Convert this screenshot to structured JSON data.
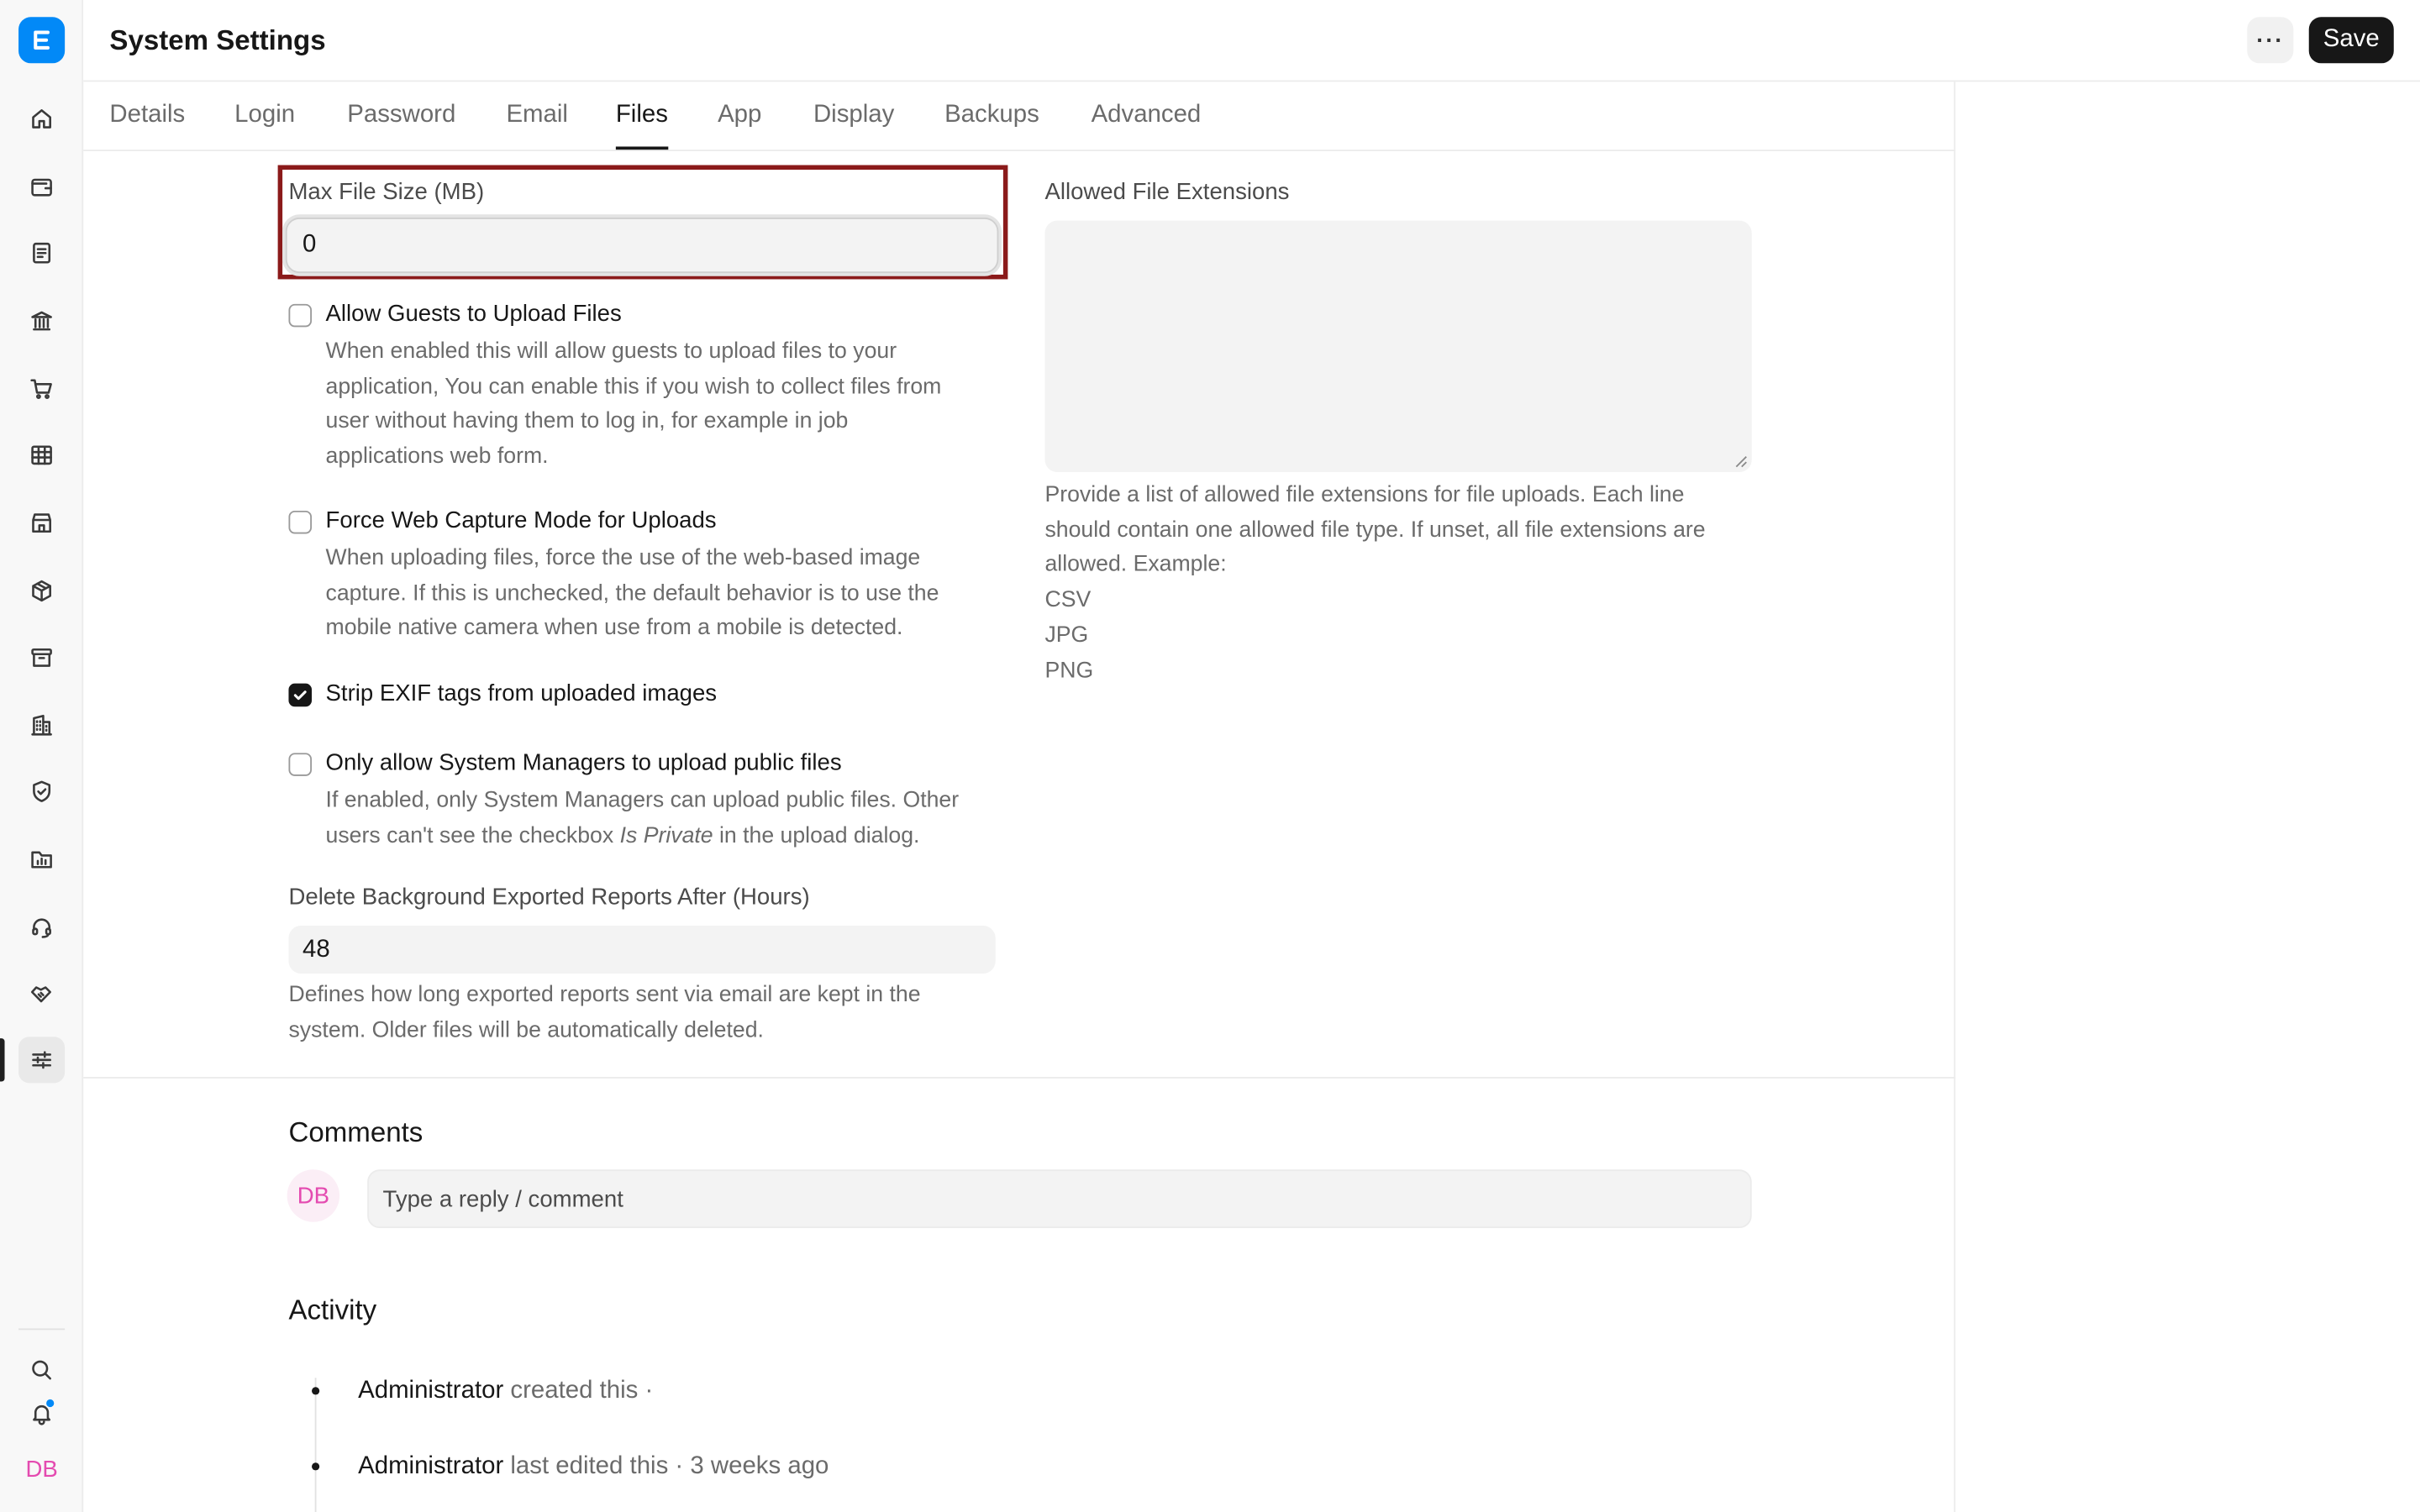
{
  "app": {
    "logo_letter": "E"
  },
  "header": {
    "title": "System Settings",
    "more_label": "···",
    "save_label": "Save"
  },
  "tabs": [
    {
      "label": "Details"
    },
    {
      "label": "Login"
    },
    {
      "label": "Password"
    },
    {
      "label": "Email"
    },
    {
      "label": "Files"
    },
    {
      "label": "App"
    },
    {
      "label": "Display"
    },
    {
      "label": "Backups"
    },
    {
      "label": "Advanced"
    }
  ],
  "active_tab": "Files",
  "form": {
    "max_file_size": {
      "label": "Max File Size (MB)",
      "value": "0"
    },
    "allowed_ext": {
      "label": "Allowed File Extensions",
      "value": "",
      "help": [
        "Provide a list of allowed file extensions for file uploads. Each line",
        "should contain one allowed file type. If unset, all file extensions are",
        "allowed. Example:",
        "CSV",
        "JPG",
        "PNG"
      ]
    },
    "allow_guests": {
      "label": "Allow Guests to Upload Files",
      "checked": false,
      "desc": [
        "When enabled this will allow guests to upload files to your",
        "application, You can enable this if you wish to collect files from",
        "user without having them to log in, for example in job",
        "applications web form."
      ]
    },
    "force_web_capture": {
      "label": "Force Web Capture Mode for Uploads",
      "checked": false,
      "desc": [
        "When uploading files, force the use of the web-based image",
        "capture. If this is unchecked, the default behavior is to use the",
        "mobile native camera when use from a mobile is detected."
      ]
    },
    "strip_exif": {
      "label": "Strip EXIF tags from uploaded images",
      "checked": true
    },
    "only_managers": {
      "label": "Only allow System Managers to upload public files",
      "checked": false,
      "desc_line1": "If enabled, only System Managers can upload public files. Other",
      "desc_line2_pre": "users can't see the checkbox ",
      "desc_line2_em": "Is Private",
      "desc_line2_post": " in the upload dialog."
    },
    "delete_reports": {
      "label": "Delete Background Exported Reports After (Hours)",
      "value": "48",
      "desc": [
        "Defines how long exported reports sent via email are kept in the",
        "system. Older files will be automatically deleted."
      ]
    }
  },
  "comments": {
    "title": "Comments",
    "avatar_initials": "DB",
    "placeholder": "Type a reply / comment"
  },
  "activity": {
    "title": "Activity",
    "items": [
      {
        "user": "Administrator",
        "text": " created this ·"
      },
      {
        "user": "Administrator",
        "text": " last edited this · 3 weeks ago"
      }
    ]
  },
  "sidebar": {
    "items": [
      {
        "icon": "home-icon"
      },
      {
        "icon": "wallet-icon"
      },
      {
        "icon": "document-icon"
      },
      {
        "icon": "bank-icon"
      },
      {
        "icon": "cart-icon"
      },
      {
        "icon": "table-icon"
      },
      {
        "icon": "store-icon"
      },
      {
        "icon": "package-icon"
      },
      {
        "icon": "archive-icon"
      },
      {
        "icon": "building-icon"
      },
      {
        "icon": "shield-icon"
      },
      {
        "icon": "folder-chart-icon"
      },
      {
        "icon": "headset-icon"
      },
      {
        "icon": "handshake-icon"
      },
      {
        "icon": "sliders-icon"
      }
    ],
    "user_initials": "DB"
  },
  "colors": {
    "accent": "#0289f7",
    "highlight": "#8b1a1a",
    "avatar_pink": "#e44bb0"
  }
}
